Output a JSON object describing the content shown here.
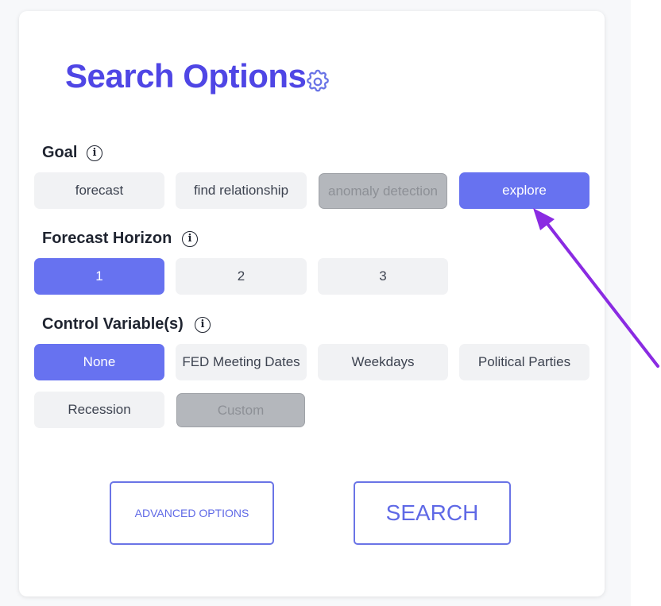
{
  "header": {
    "title": "Search Options",
    "icon": "gear-icon"
  },
  "goal": {
    "label": "Goal",
    "options": [
      {
        "label": "forecast",
        "state": "default"
      },
      {
        "label": "find relationship",
        "state": "default"
      },
      {
        "label": "anomaly detection",
        "state": "disabled"
      },
      {
        "label": "explore",
        "state": "selected"
      }
    ]
  },
  "forecast_horizon": {
    "label": "Forecast Horizon",
    "options": [
      {
        "label": "1",
        "state": "selected"
      },
      {
        "label": "2",
        "state": "default"
      },
      {
        "label": "3",
        "state": "default"
      }
    ]
  },
  "control_variables": {
    "label": "Control Variable(s)",
    "options": [
      {
        "label": "None",
        "state": "selected"
      },
      {
        "label": "FED Meeting Dates",
        "state": "default"
      },
      {
        "label": "Weekdays",
        "state": "default"
      },
      {
        "label": "Political Parties",
        "state": "default"
      },
      {
        "label": "Recession",
        "state": "default"
      },
      {
        "label": "Custom",
        "state": "disabled"
      }
    ]
  },
  "actions": {
    "advanced_label": "ADVANCED OPTIONS",
    "search_label": "SEARCH"
  },
  "colors": {
    "accent": "#4f46e5",
    "selected": "#6772f0",
    "default": "#f1f2f4",
    "disabled": "#b4b7bc",
    "annotation_arrow": "#8a2be2"
  },
  "info_glyph": "i"
}
